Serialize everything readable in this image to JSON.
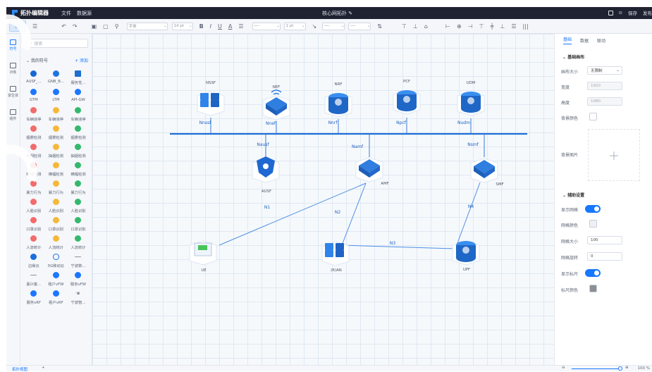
{
  "app": {
    "title": "拓扑编辑器",
    "menus": [
      "文件",
      "数据源"
    ],
    "document_title": "核心网拓扑 ✎",
    "top_actions": [
      "保存",
      "发布"
    ]
  },
  "toolbar": {
    "font": "字体",
    "font_size": "14 pt",
    "bold": "B",
    "italic": "I",
    "underline": "U",
    "font_color": "A",
    "line_width": "1 pt"
  },
  "left_rail": {
    "items": [
      "符号",
      "对象",
      "孪生体",
      "组件"
    ]
  },
  "symbols": {
    "search_placeholder": "搜索",
    "group": "我的符号",
    "add": "+ 添加",
    "items": [
      {
        "label": "AUSF_...",
        "color": "#1767d6",
        "shape": "shield"
      },
      {
        "label": "GNB_B...",
        "color": "#1b76e2",
        "shape": "tower"
      },
      {
        "label": "服务性...",
        "color": "#1c6fcf",
        "shape": "screen"
      },
      {
        "label": "GTM",
        "color": "#1b77ff",
        "shape": "hex"
      },
      {
        "label": "LTM",
        "color": "#1b77ff",
        "shape": "hex"
      },
      {
        "label": "API-GW",
        "color": "#1b77ff",
        "shape": "hex"
      },
      {
        "label": "车辆违停",
        "color": "#f46b6b",
        "shape": "dot"
      },
      {
        "label": "车辆违停",
        "color": "#f5b83a",
        "shape": "dot"
      },
      {
        "label": "车辆违停",
        "color": "#35b86d",
        "shape": "dot"
      },
      {
        "label": "烟雾检测",
        "color": "#f46b6b",
        "shape": "dot"
      },
      {
        "label": "烟雾检测",
        "color": "#f5b83a",
        "shape": "dot"
      },
      {
        "label": "烟雾检测",
        "color": "#35b86d",
        "shape": "dot"
      },
      {
        "label": "抽烟检测",
        "color": "#f46b6b",
        "shape": "dot"
      },
      {
        "label": "抽烟检测",
        "color": "#f5b83a",
        "shape": "dot"
      },
      {
        "label": "抽烟检测",
        "color": "#35b86d",
        "shape": "dot"
      },
      {
        "label": "横幅检测",
        "color": "#f46b6b",
        "shape": "dot"
      },
      {
        "label": "横幅检测",
        "color": "#f5b83a",
        "shape": "dot"
      },
      {
        "label": "横幅检测",
        "color": "#35b86d",
        "shape": "dot"
      },
      {
        "label": "暴力行为",
        "color": "#f46b6b",
        "shape": "dot"
      },
      {
        "label": "暴力行为",
        "color": "#f5b83a",
        "shape": "dot"
      },
      {
        "label": "暴力行为",
        "color": "#35b86d",
        "shape": "dot"
      },
      {
        "label": "人脸识别",
        "color": "#f46b6b",
        "shape": "dot"
      },
      {
        "label": "人脸识别",
        "color": "#f5b83a",
        "shape": "dot"
      },
      {
        "label": "人脸识别",
        "color": "#35b86d",
        "shape": "dot"
      },
      {
        "label": "口罩识别",
        "color": "#f46b6b",
        "shape": "dot"
      },
      {
        "label": "口罩识别",
        "color": "#f5b83a",
        "shape": "dot"
      },
      {
        "label": "口罩识别",
        "color": "#35b86d",
        "shape": "dot"
      },
      {
        "label": "人流统计",
        "color": "#f46b6b",
        "shape": "dot"
      },
      {
        "label": "人流统计",
        "color": "#f5b83a",
        "shape": "dot"
      },
      {
        "label": "人流统计",
        "color": "#35b86d",
        "shape": "dot"
      },
      {
        "label": "边缘云",
        "color": "#1b6ee0",
        "shape": "cloud"
      },
      {
        "label": "5G移动云",
        "color": "#1b6ee0",
        "shape": "cloud-outline"
      },
      {
        "label": "宁波数...",
        "color": "#8a94a3",
        "shape": "line"
      },
      {
        "label": "嘉兴客...",
        "color": "#8a94a3",
        "shape": "line"
      },
      {
        "label": "租户vFW",
        "color": "#1b77ff",
        "shape": "dot"
      },
      {
        "label": "服务vFW",
        "color": "#1b77ff",
        "shape": "dot"
      },
      {
        "label": "服务vRF",
        "color": "#1b77ff",
        "shape": "dot"
      },
      {
        "label": "租户vRF",
        "color": "#1b77ff",
        "shape": "dot"
      },
      {
        "label": "宁波智...",
        "color": "#8a94a3",
        "shape": "dots"
      }
    ]
  },
  "topology": {
    "nodes": [
      {
        "id": "NSSF",
        "label": "NSSF",
        "kind": "servers"
      },
      {
        "id": "NEF",
        "label": "NEF",
        "kind": "router"
      },
      {
        "id": "NRF",
        "label": "NRF",
        "kind": "cylinder"
      },
      {
        "id": "PCF",
        "label": "PCF",
        "kind": "database"
      },
      {
        "id": "UDM",
        "label": "UDM",
        "kind": "cylinder-user"
      },
      {
        "id": "AUSF",
        "label": "AUSF",
        "kind": "shield"
      },
      {
        "id": "AMF",
        "label": "AMF",
        "kind": "switch"
      },
      {
        "id": "SMF",
        "label": "SMF",
        "kind": "switch"
      },
      {
        "id": "UE",
        "label": "UE",
        "kind": "device"
      },
      {
        "id": "RAN",
        "label": "(R)AN",
        "kind": "rack"
      },
      {
        "id": "UPF",
        "label": "UPF",
        "kind": "router-cylinder"
      }
    ],
    "service_labels": [
      "Nnssf",
      "Nnef",
      "Nnrf",
      "Npcf",
      "Nudm",
      "Nausf",
      "Namf",
      "Nsmf"
    ],
    "links": [
      {
        "from": "UE",
        "to": "AMF",
        "label": "N1"
      },
      {
        "from": "RAN",
        "to": "AMF",
        "label": "N2"
      },
      {
        "from": "RAN",
        "to": "UPF",
        "label": "N3"
      },
      {
        "from": "SMF",
        "to": "UPF",
        "label": "N4"
      }
    ]
  },
  "properties": {
    "tabs": [
      "基础",
      "数据",
      "联动"
    ],
    "basic_title": "基础画布",
    "canvas_size_label": "画布大小",
    "canvas_size": "无限制",
    "width_label": "宽度",
    "width": "1920",
    "height_label": "高度",
    "height": "1080",
    "bg_color_label": "背景颜色",
    "bg_image_label": "背景图片",
    "aux_title": "辅助设置",
    "show_grid_label": "显示网格",
    "grid_color_label": "网格颜色",
    "grid_size_label": "网格大小",
    "grid_size": "100",
    "grid_rotation_label": "网格旋转",
    "grid_rotation": "0",
    "show_ruler_label": "显示标尺",
    "ruler_color_label": "标尺颜色"
  },
  "footer": {
    "tab": "拓扑视图",
    "add": "+",
    "zoom_percent": "100 %"
  }
}
